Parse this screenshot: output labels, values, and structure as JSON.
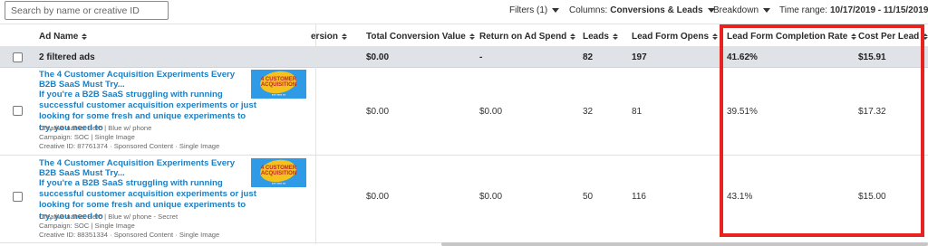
{
  "toolbar": {
    "search_placeholder": "Search by name or creative ID",
    "filters_label": "Filters (1)",
    "columns_label": "Columns:",
    "columns_value": "Conversions & Leads",
    "breakdown_label": "Breakdown",
    "time_range_label": "Time range:",
    "time_range_value": "10/17/2019 - 11/15/2019"
  },
  "columns": {
    "ad_name": "Ad Name",
    "conversion_partial": "ersion",
    "total_conversion_value": "Total Conversion Value",
    "return_on_ad_spend": "Return on Ad Spend",
    "leads": "Leads",
    "lead_form_opens": "Lead Form Opens",
    "lead_form_completion_rate": "Lead Form Completion Rate",
    "cost_per_lead": "Cost Per Lead"
  },
  "summary": {
    "label": "2 filtered ads",
    "total_conversion_value": "$0.00",
    "return_on_ad_spend": "-",
    "leads": "82",
    "lead_form_opens": "197",
    "lead_form_completion_rate": "41.62%",
    "cost_per_lead": "$15.91"
  },
  "rows": [
    {
      "title": "The 4 Customer Acquisition Experiments Every B2B SaaS Must Try...",
      "body": "If you're a B2B SaaS struggling with running successful customer acquisition experiments or just looking for some fresh and unique experiments to try, you need to",
      "creative_name": "Creative name: Hero | Blue w/ phone",
      "campaign": "Campaign: SOC | Single Image",
      "creative_id": "Creative ID: 87761374 · Sponsored Content · Single Image",
      "total_conversion_value": "$0.00",
      "return_on_ad_spend": "$0.00",
      "leads": "32",
      "lead_form_opens": "81",
      "lead_form_completion_rate": "39.51%",
      "cost_per_lead": "$17.32"
    },
    {
      "title": "The 4 Customer Acquisition Experiments Every B2B SaaS Must Try...",
      "body": "If you're a B2B SaaS struggling with running successful customer acquisition experiments or just looking for some fresh and unique experiments to try, you need to",
      "creative_name": "Creative name: Hero | Blue w/ phone - Secret",
      "campaign": "Campaign: SOC | Single Image",
      "creative_id": "Creative ID: 88351334 · Sponsored Content · Single Image",
      "total_conversion_value": "$0.00",
      "return_on_ad_spend": "$0.00",
      "leads": "50",
      "lead_form_opens": "116",
      "lead_form_completion_rate": "43.1%",
      "cost_per_lead": "$15.00"
    }
  ],
  "colors": {
    "link": "#1d7fc2",
    "summary_bg": "#dfe2e6",
    "highlight": "#e6231e",
    "thumb_blue": "#2f9be6",
    "thumb_yellow": "#f4c21b"
  }
}
